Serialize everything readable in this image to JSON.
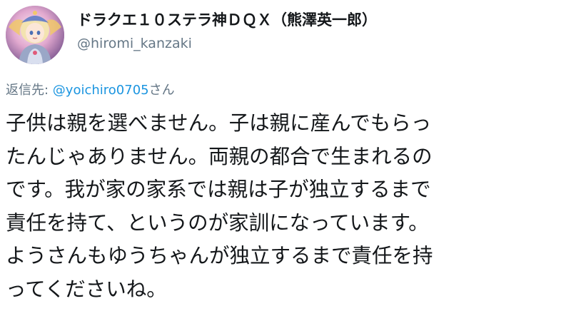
{
  "tweet": {
    "display_name": "ドラクエ１０ステラ神ＤＱＸ（熊澤英一郎）",
    "username": "@hiromi_kanzaki",
    "reply_prefix": "返信先: ",
    "reply_mention": "@yoichiro0705",
    "reply_suffix": "さん",
    "text_lines": [
      "子供は親を選べません。子は親に産んでもらっ",
      "たんじゃありません。両親の都合で生まれるの",
      "です。我が家の家系では親は子が独立するまで",
      "責任を持て、というのが家訓になっています。",
      "ようさんもゆうちゃんが独立するまで責任を持",
      "ってくださいね。"
    ]
  },
  "colors": {
    "text": "#14171a",
    "secondary": "#657786",
    "link": "#1b95e0",
    "background": "#ffffff"
  },
  "icons": {
    "avatar": "avatar-anime-character"
  }
}
